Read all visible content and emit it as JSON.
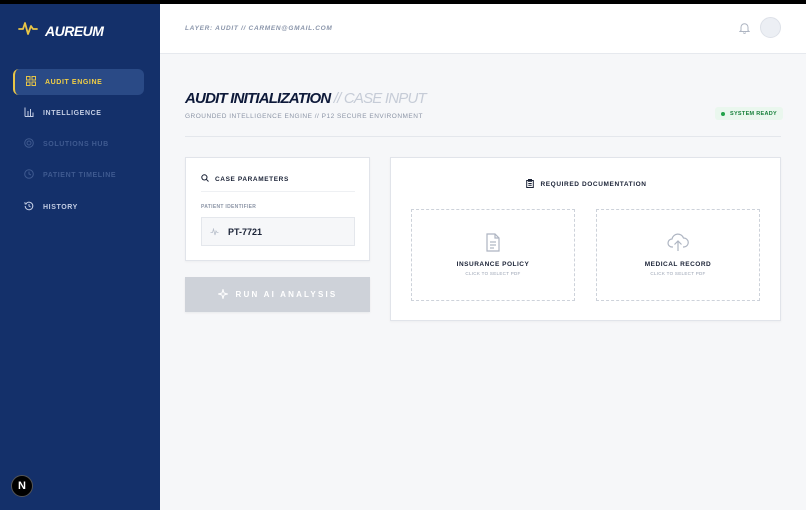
{
  "brand": {
    "name": "AUREUM",
    "logo_icon": "pulse-icon",
    "accent": "#e8c547"
  },
  "sidebar": {
    "items": [
      {
        "label": "AUDIT ENGINE",
        "icon": "grid-icon",
        "state": "active"
      },
      {
        "label": "INTELLIGENCE",
        "icon": "bar-chart-icon",
        "state": "normal"
      },
      {
        "label": "SOLUTIONS HUB",
        "icon": "target-icon",
        "state": "disabled"
      },
      {
        "label": "PATIENT TIMELINE",
        "icon": "clock-icon",
        "state": "disabled"
      },
      {
        "label": "HISTORY",
        "icon": "history-icon",
        "state": "normal"
      }
    ],
    "badge": "N"
  },
  "header": {
    "layer_text": "LAYER: AUDIT // CARMEN@GMAIL.COM"
  },
  "page": {
    "title": "AUDIT INITIALIZATION",
    "title_suffix": " // CASE INPUT",
    "subtitle": "GROUNDED INTELLIGENCE ENGINE // P12 SECURE ENVIRONMENT",
    "status": "SYSTEM READY"
  },
  "case_parameters": {
    "title": "CASE PARAMETERS",
    "field_label": "PATIENT IDENTIFIER",
    "field_value": "PT-7721"
  },
  "run_button": {
    "label": "RUN AI ANALYSIS"
  },
  "documentation": {
    "title": "REQUIRED DOCUMENTATION",
    "items": [
      {
        "title": "INSURANCE POLICY",
        "subtitle": "CLICK TO SELECT PDF"
      },
      {
        "title": "MEDICAL RECORD",
        "subtitle": "CLICK TO SELECT PDF"
      }
    ]
  }
}
